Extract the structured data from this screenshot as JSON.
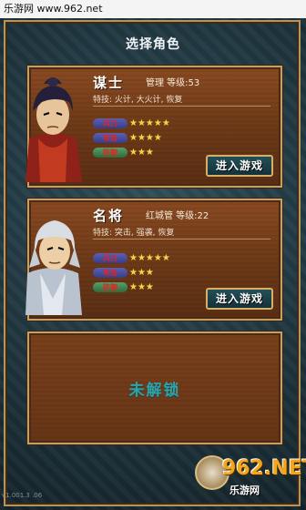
{
  "watermark": {
    "top": "乐游网 www.962.net",
    "bottom": "v1.001.3 .06"
  },
  "page": {
    "title": "选择角色"
  },
  "roles": [
    {
      "name": "谋士",
      "meta": "管理 等级:53",
      "skills": "特技: 火计, 大火计, 恢复",
      "stats": [
        {
          "label": "兵力",
          "stars": "★★★★★",
          "level": 5
        },
        {
          "label": "攻击",
          "stars": "★★★★",
          "level": 4
        },
        {
          "label": "防御",
          "stars": "★★★",
          "level": 3
        }
      ],
      "button": "进入游戏"
    },
    {
      "name": "名将",
      "meta": "红城管 等级:22",
      "skills": "特技: 突击, 强袭, 恢复",
      "stats": [
        {
          "label": "兵力",
          "stars": "★★★★★",
          "level": 5
        },
        {
          "label": "攻击",
          "stars": "★★★",
          "level": 3
        },
        {
          "label": "防御",
          "stars": "★★★",
          "level": 3
        }
      ],
      "button": "进入游戏"
    }
  ],
  "locked": {
    "text": "未解锁"
  },
  "brand": {
    "main": "962.NET",
    "sub": "乐游网"
  }
}
